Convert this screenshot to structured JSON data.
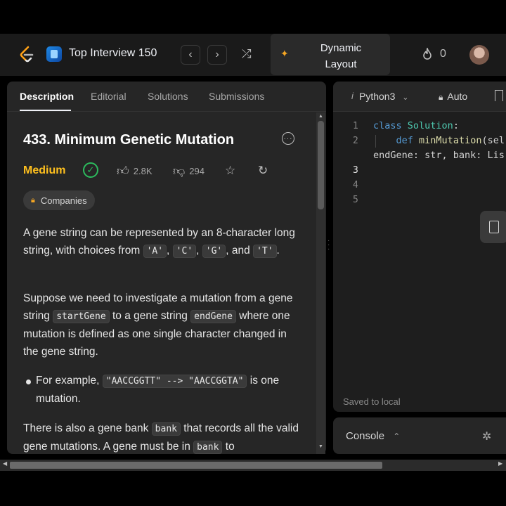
{
  "topbar": {
    "study_plan": "Top Interview 150",
    "prev_icon": "chevron-left-icon",
    "next_icon": "chevron-right-icon",
    "shuffle_icon": "shuffle-icon",
    "dynamic_layout_line1": "Dynamic",
    "dynamic_layout_line2": "Layout",
    "streak_count": "0"
  },
  "tabs": [
    "Description",
    "Editorial",
    "Solutions",
    "Submissions"
  ],
  "problem": {
    "title": "433. Minimum Genetic Mutation",
    "difficulty": "Medium",
    "likes": "2.8K",
    "dislikes": "294",
    "companies_label": "Companies",
    "p1_a": "A gene string can be represented by an 8-character long string, with choices from ",
    "p1_c1": "'A'",
    "p1_c2": "'C'",
    "p1_c3": "'G'",
    "p1_and": ", and",
    "p1_c4": "'T'",
    "p2_a": "Suppose we need to investigate a mutation from a gene string ",
    "p2_c1": "startGene",
    "p2_b": " to a gene string ",
    "p2_c2": "endGene",
    "p2_c": " where one mutation is defined as one single character changed in the gene string.",
    "bullet_a": "For example, ",
    "bullet_code": "\"AACCGGTT\" --> \"AACCGGTA\"",
    "bullet_b": " is one mutation.",
    "p3_a": "There is also a gene bank ",
    "p3_c1": "bank",
    "p3_b": " that records all the valid gene mutations. A gene must be in ",
    "p3_c2": "bank",
    "p3_c": " to"
  },
  "editor": {
    "language": "Python3",
    "auto_label": "Auto",
    "line_numbers": [
      "1",
      "2",
      "3",
      "4",
      "5"
    ],
    "code_line1_kw": "class",
    "code_line1_name": "Solution",
    "code_line1_end": ":",
    "code_line2_kw": "def",
    "code_line2_fn": "minMutation",
    "code_line2_rest": "(sel",
    "code_line2_wrap": "endGene: str, bank: Lis",
    "saved_label": "Saved to local"
  },
  "console": {
    "label": "Console"
  },
  "colors": {
    "medium": "#ffc01e",
    "solved": "#2cbb5d",
    "keyword": "#569cd6"
  }
}
